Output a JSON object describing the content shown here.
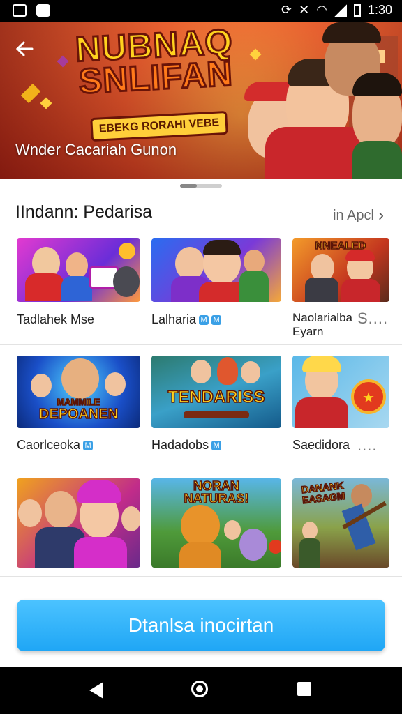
{
  "status_bar": {
    "time": "1:30"
  },
  "banner": {
    "title_line1": "NUBNAQ",
    "title_line2": "SNLIFAN",
    "ribbon": "EBEKG RORAHI VEBE",
    "subtitle": "Wnder Cacariah Gunon",
    "colors": {
      "bg": "#e4572e",
      "title": "#ffd21e"
    }
  },
  "section": {
    "title": "IIndann: Pedarisa",
    "link": "in Apcl"
  },
  "grid": {
    "row1": [
      {
        "label": "Tadlahek Mse"
      },
      {
        "label": "Lalharia",
        "badges": [
          "M",
          "M"
        ]
      },
      {
        "label_line1": "Naolarialba",
        "label_line2": "Eyarn",
        "caption": "NNEALED",
        "more": "S...."
      }
    ],
    "row2": [
      {
        "label": "Caorlceoka",
        "badge": "M",
        "caption_line1": "MAMMILE",
        "caption_line2": "DEPOANEN"
      },
      {
        "label": "Hadadobs",
        "badge": "M",
        "caption": "TENDARISS"
      },
      {
        "label": "Saedidora",
        "more": "...."
      }
    ],
    "row3": [
      {
        "caption": ""
      },
      {
        "caption_line1": "NORAN",
        "caption_line2": "NATURAS!"
      },
      {
        "caption_line1": "DANANK",
        "caption_line2": "EASAGM"
      }
    ]
  },
  "cta": {
    "label": "Dtanlsa inocirtan",
    "color": "#1fa6f5"
  }
}
